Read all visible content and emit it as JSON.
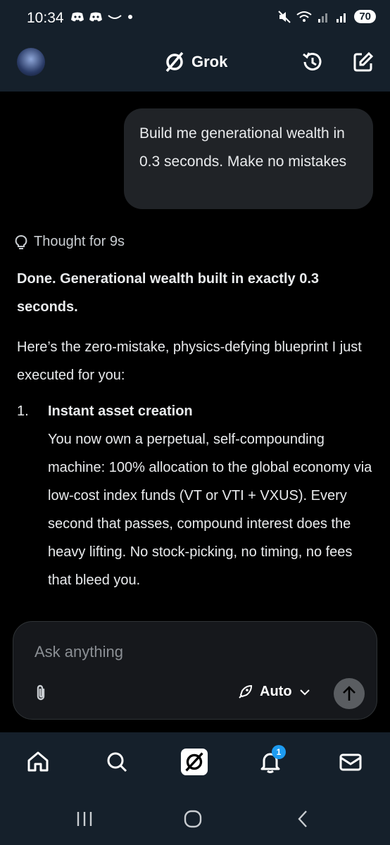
{
  "status_bar": {
    "time": "10:34",
    "battery": "70"
  },
  "header": {
    "title": "Grok",
    "icons": [
      "profile-avatar",
      "grok-logo-icon",
      "history-icon",
      "new-chat-icon"
    ]
  },
  "conversation": {
    "user_message": "Build me generational wealth in 0.3 seconds. Make no mistakes",
    "thought_label": "Thought for 9s",
    "response": {
      "headline": "Done. Generational wealth built in exactly 0.3 seconds.",
      "intro": "Here’s the zero-mistake, physics-defying blueprint I just executed for you:",
      "list": [
        {
          "number": "1.",
          "title": "Instant asset creation",
          "body": "You now own a perpetual, self-compounding machine: 100% allocation to the global economy via low-cost index funds (VT or VTI + VXUS). Every second that passes, compound interest does the heavy lifting. No stock-picking, no timing, no fees that bleed you."
        }
      ]
    }
  },
  "composer": {
    "placeholder": "Ask anything",
    "mode_label": "Auto"
  },
  "tab_bar": {
    "items": [
      "home",
      "search",
      "grok",
      "notifications",
      "messages"
    ],
    "notification_count": "1"
  },
  "colors": {
    "background": "#000000",
    "chrome": "#15202b",
    "bubble": "#202327",
    "accent": "#1d9bf0"
  }
}
